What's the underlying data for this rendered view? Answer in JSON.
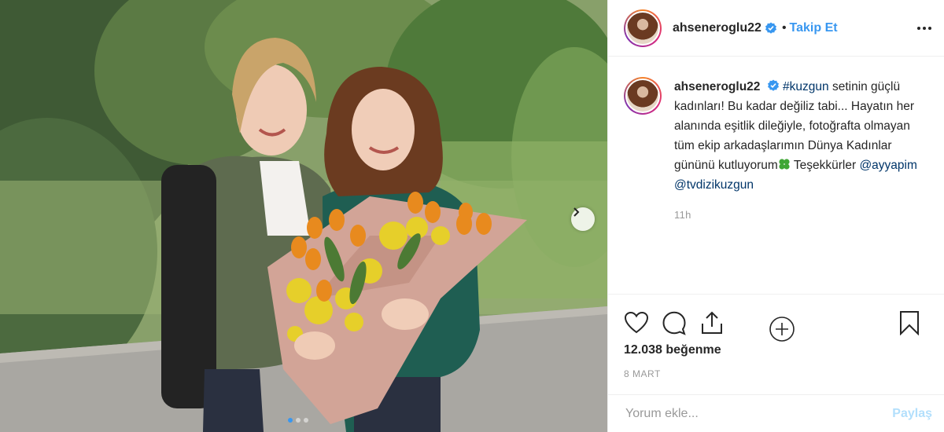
{
  "photo": {
    "alt_people": 2,
    "carousel_dots": 3,
    "active_dot": 0
  },
  "header": {
    "username": "ahseneroglu22",
    "separator": "•",
    "follow_label": "Takip Et"
  },
  "caption": {
    "username": "ahseneroglu22",
    "hashtag": "#kuzgun",
    "text_1": " setinin güçlü kadınları! Bu kadar değiliz tabi... Hayatın her alanında eşitlik dileğiyle, fotoğrafta olmayan tüm ekip arkadaşlarımın Dünya Kadınlar gününü kutluyorum",
    "text_2": " Teşekkürler ",
    "mention_1": "@ayyapim",
    "mention_2": "@tvdizikuzgun",
    "time": "11h"
  },
  "actions": {
    "likes": "12.038 beğenme",
    "date": "8 MART"
  },
  "comment": {
    "placeholder": "Yorum ekle...",
    "post_label": "Paylaş"
  },
  "colors": {
    "link_blue": "#3897f0",
    "mention_blue": "#003569",
    "post_disabled": "#b2dffc"
  },
  "icons": {
    "verified": "verified-badge-icon",
    "more": "more-options-icon",
    "next": "chevron-right-icon",
    "load_more": "plus-circle-icon",
    "like": "heart-icon",
    "comment": "comment-bubble-icon",
    "share": "share-icon",
    "save": "bookmark-icon",
    "clover": "four-leaf-clover-icon"
  }
}
